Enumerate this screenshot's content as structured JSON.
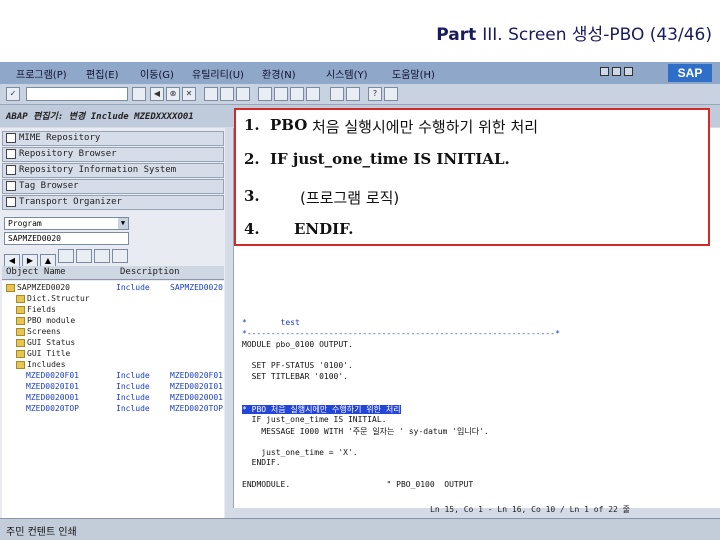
{
  "slide": {
    "title_part": "Part",
    "title_rest": "III. Screen 생성-PBO (43/46)"
  },
  "window": {
    "menu": [
      "프로그램(P)",
      "편집(E)",
      "이동(G)",
      "유틸리티(U)",
      "환경(N)",
      "시스템(Y)",
      "도움말(H)"
    ],
    "logo": "SAP",
    "app_title": "ABAP 편집기: 변경  Include  MZEDXXXXO01"
  },
  "nav": {
    "buttons": [
      "MIME Repository",
      "Repository Browser",
      "Repository Information System",
      "Tag Browser",
      "Transport Organizer"
    ],
    "combo1": "Program",
    "combo2": "SAPMZED0020"
  },
  "tree": {
    "headers": [
      "Object Name",
      "Description"
    ],
    "rows": [
      {
        "name": "SAPMZED0020",
        "type": "Include",
        "desc": "SAPMZED0020",
        "indent": 0,
        "folder": true,
        "hl": false
      },
      {
        "name": "Dict.Structur",
        "type": "",
        "desc": "",
        "indent": 1,
        "folder": true,
        "hl": false
      },
      {
        "name": "Fields",
        "type": "",
        "desc": "",
        "indent": 1,
        "folder": true,
        "hl": false
      },
      {
        "name": "PBO module",
        "type": "",
        "desc": "",
        "indent": 1,
        "folder": true,
        "hl": false
      },
      {
        "name": "Screens",
        "type": "",
        "desc": "",
        "indent": 1,
        "folder": true,
        "hl": false
      },
      {
        "name": "GUI Status",
        "type": "",
        "desc": "",
        "indent": 1,
        "folder": true,
        "hl": false
      },
      {
        "name": "GUI Title",
        "type": "",
        "desc": "",
        "indent": 1,
        "folder": true,
        "hl": false
      },
      {
        "name": "Includes",
        "type": "",
        "desc": "",
        "indent": 1,
        "folder": true,
        "hl": false
      },
      {
        "name": "MZED0020F01",
        "type": "Include",
        "desc": "MZED0020F01",
        "indent": 2,
        "folder": false,
        "hl": true
      },
      {
        "name": "MZED0020I01",
        "type": "Include",
        "desc": "MZED0020I01",
        "indent": 2,
        "folder": false,
        "hl": true
      },
      {
        "name": "MZED0020O01",
        "type": "Include",
        "desc": "MZED0020O01",
        "indent": 2,
        "folder": false,
        "hl": true
      },
      {
        "name": "MZED0020TOP",
        "type": "Include",
        "desc": "MZED0020TOP",
        "indent": 2,
        "folder": false,
        "hl": true
      }
    ]
  },
  "editor": {
    "lines": [
      {
        "text": "*       test",
        "cls": "blue"
      },
      {
        "text": "*----------------------------------------------------------------*",
        "cls": "blue"
      },
      {
        "text": "MODULE pbo_0100 OUTPUT.",
        "cls": ""
      },
      {
        "text": "",
        "cls": ""
      },
      {
        "text": "  SET PF-STATUS '0100'.",
        "cls": ""
      },
      {
        "text": "  SET TITLEBAR '0100'.",
        "cls": ""
      },
      {
        "text": "",
        "cls": ""
      },
      {
        "text": "",
        "cls": ""
      },
      {
        "text": "* PBO 처음 실행시에만 수행하기 위한 처리",
        "cls": "hl"
      },
      {
        "text": "  IF just_one_time IS INITIAL.",
        "cls": ""
      },
      {
        "text": "    MESSAGE I000 WITH '주문 일자는 ' sy-datum '입니다'.",
        "cls": ""
      },
      {
        "text": "",
        "cls": ""
      },
      {
        "text": "    just_one_time = 'X'.",
        "cls": ""
      },
      {
        "text": "  ENDIF.",
        "cls": ""
      },
      {
        "text": "",
        "cls": ""
      },
      {
        "text": "ENDMODULE.                    \" PBO_0100  OUTPUT",
        "cls": ""
      }
    ]
  },
  "callout": {
    "line1_num": "1.",
    "line1_a": "PBO ",
    "line1_b": "처음 실행시에만 수행하기 위한 처리",
    "line2_num": "2.",
    "line2_text": "IF just_one_time IS INITIAL.",
    "line3_num": "3.",
    "line3_text": "(프로그램 로직)",
    "line4_num": "4.",
    "line4_text": "ENDIF."
  },
  "status": {
    "left": "주민 컨텐트 인쇄",
    "right": "Ln 15, Co 1 - Ln 16, Co 10 / Ln 1 of 22 줄"
  }
}
